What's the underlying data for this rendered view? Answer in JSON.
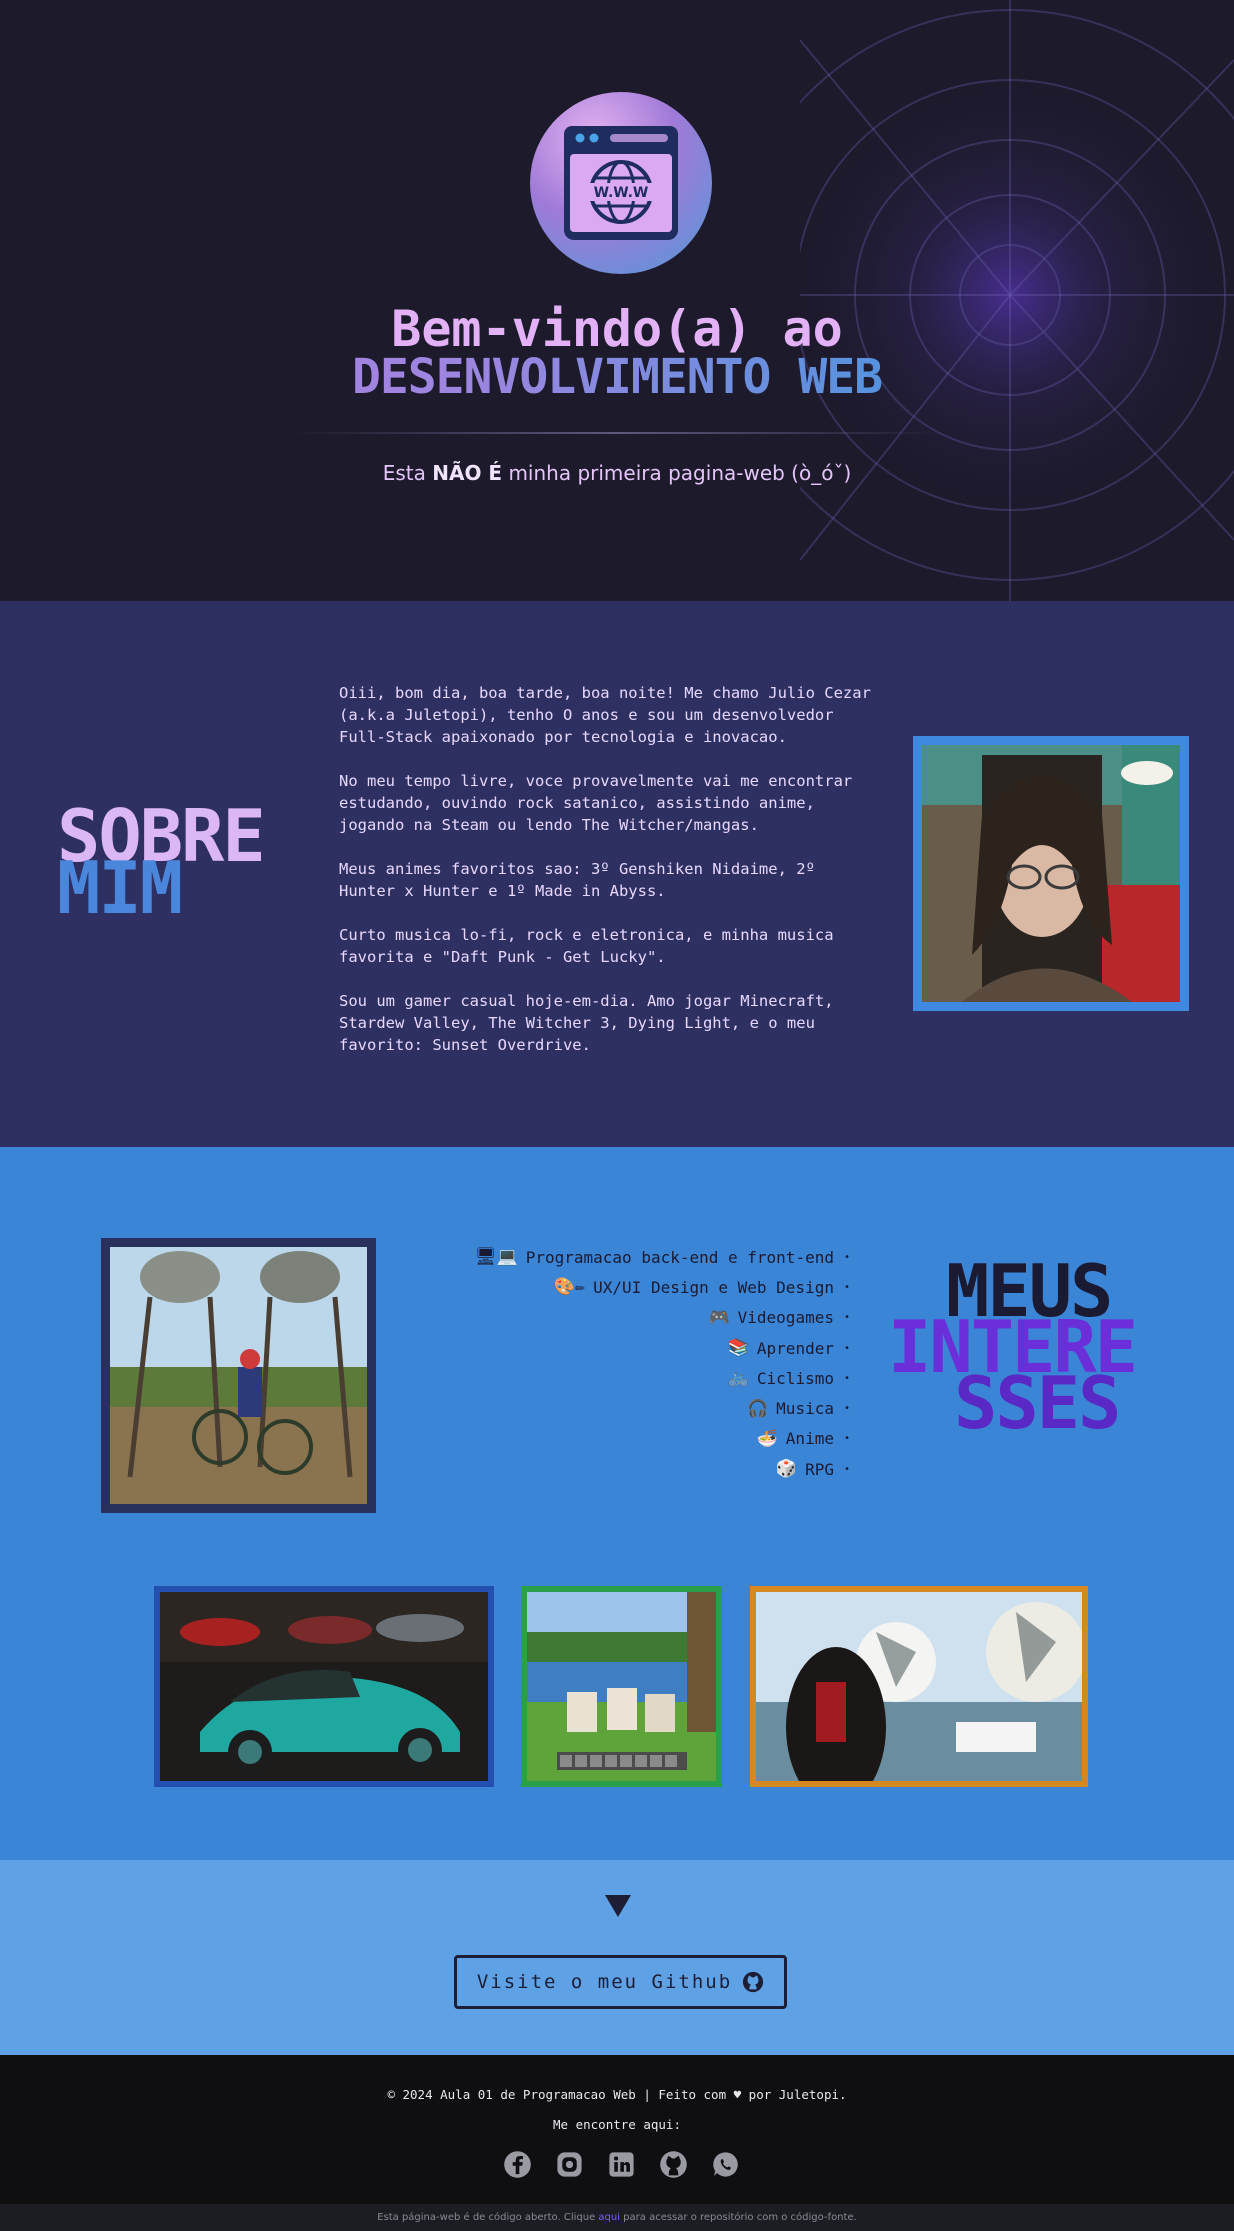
{
  "hero": {
    "title_line1": "Bem-vindo(a) ao",
    "title_line2": "DESENVOLVIMENTO WEB",
    "subtitle_pre": "Esta ",
    "subtitle_bold": "NÃO É",
    "subtitle_post": " minha primeira pagina-web (ò_óˇ)",
    "logo_text": "W.W.W"
  },
  "about": {
    "heading_word1": "SOBRE",
    "heading_word2": "MIM",
    "paragraphs": [
      "Oiii, bom dia, boa tarde, boa noite! Me chamo Julio Cezar (a.k.a Juletopi), tenho O anos e sou um desenvolvedor Full-Stack apaixonado por tecnologia e inovacao.",
      "No meu tempo livre, voce provavelmente vai me encontrar estudando, ouvindo rock satanico, assistindo anime, jogando na Steam ou lendo The Witcher/mangas.",
      "Meus animes favoritos sao: 3º Genshiken Nidaime, 2º Hunter x Hunter e 1º Made in Abyss.",
      "Curto musica lo-fi, rock e eletronica, e minha musica favorita e \"Daft Punk - Get Lucky\".",
      "Sou um gamer casual hoje-em-dia. Amo jogar Minecraft, Stardew Valley, The Witcher 3, Dying Light, e o meu favorito: Sunset Overdrive."
    ]
  },
  "interests": {
    "heading_word1": "MEUS",
    "heading_word2": "INTERE",
    "heading_word3": "SSES",
    "items": [
      {
        "icon": "🖥💻",
        "label": "Programacao back-end e front-end"
      },
      {
        "icon": "🎨✏",
        "label": "UX/UI Design e Web Design"
      },
      {
        "icon": "🎮",
        "label": "Videogames"
      },
      {
        "icon": "📚",
        "label": "Aprender"
      },
      {
        "icon": "🚲",
        "label": "Ciclismo"
      },
      {
        "icon": "🎧",
        "label": "Musica"
      },
      {
        "icon": "🍜",
        "label": "Anime"
      },
      {
        "icon": "🎲",
        "label": "RPG"
      }
    ],
    "bullet": "•"
  },
  "cta": {
    "label": "Visite o meu Github"
  },
  "footer": {
    "line1": "© 2024 Aula 01 de Programacao Web  |  Feito com ♥ por Juletopi.",
    "line2": "Me encontre aqui:",
    "bottom_pre": "Esta página-web é de código aberto. Clique ",
    "bottom_link": "aqui",
    "bottom_post": " para acessar o repositório com o código-fonte."
  },
  "colors": {
    "hero_bg": "#1d1a2c",
    "about_bg": "#2e3061",
    "interests_bg": "#3b85d6",
    "cta_bg": "#5ea1e4",
    "footer_bg": "#0f0f12",
    "accent_purple": "#dcb7f6",
    "accent_blue": "#4a87dc"
  }
}
